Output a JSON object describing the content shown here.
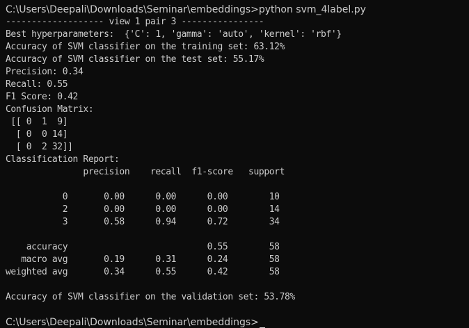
{
  "terminal": {
    "background": "#0c0c0c",
    "foreground": "#cccccc",
    "command_line": "C:\\Users\\Deepali\\Downloads\\Seminar\\embeddings>python svm_4label.py",
    "section_header": "------------------- view 1 pair 3 ----------------",
    "best_hyperparameters": "Best hyperparameters:  {'C': 1, 'gamma': 'auto', 'kernel': 'rbf'}",
    "training_accuracy": "Accuracy of SVM classifier on the training set: 63.12%",
    "test_accuracy": "Accuracy of SVM classifier on the test set: 55.17%",
    "precision": "Precision: 0.34",
    "recall": "Recall: 0.55",
    "f1_score": "F1 Score: 0.42",
    "confusion_matrix_title": "Confusion Matrix:",
    "confusion_matrix_rows": [
      " [[ 0  1  9]",
      "  [ 0  0 14]",
      "  [ 0  2 32]]"
    ],
    "classification_report_title": "Classification Report:",
    "report_header": "               precision    recall  f1-score   support",
    "report_rows": [
      "           0       0.00      0.00      0.00        10",
      "           2       0.00      0.00      0.00        14",
      "           3       0.58      0.94      0.72        34"
    ],
    "report_summary": [
      "    accuracy                           0.55        58",
      "   macro avg       0.19      0.31      0.24        58",
      "weighted avg       0.34      0.55      0.42        58"
    ],
    "validation_accuracy": "Accuracy of SVM classifier on the validation set: 53.78%",
    "prompt_line": "C:\\Users\\Deepali\\Downloads\\Seminar\\embeddings>"
  }
}
